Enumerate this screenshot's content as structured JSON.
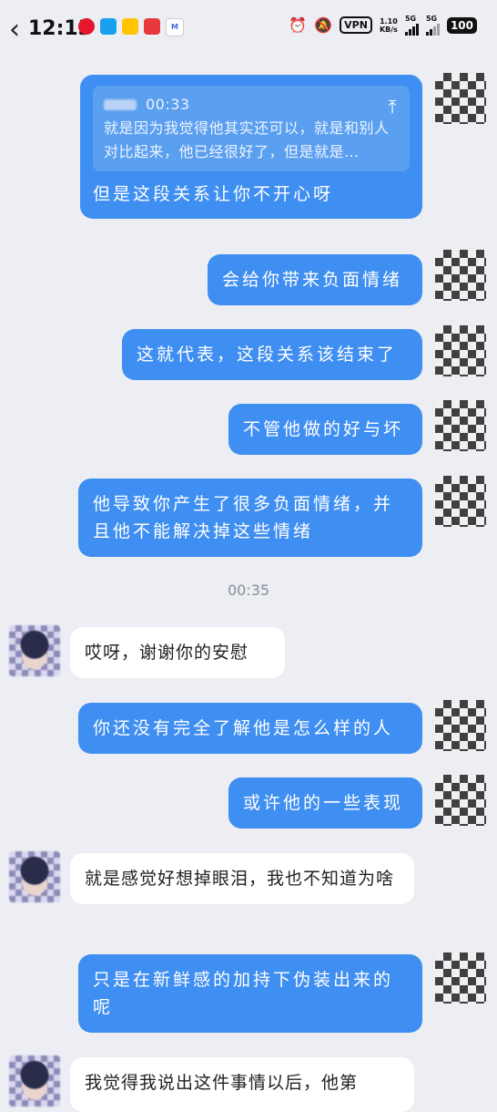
{
  "status_bar": {
    "time": "12:13",
    "vpn": "VPN",
    "speed_value": "1.10",
    "speed_unit": "KB/s",
    "net1": "5G",
    "net2": "5G",
    "battery": "100"
  },
  "messages": [
    {
      "dir": "out",
      "quote_time": "00:33",
      "quote_text": "就是因为我觉得他其实还可以，就是和别人对比起来，他已经很好了，但是就是…",
      "text": "但是这段关系让你不开心呀"
    },
    {
      "dir": "out",
      "text": "会给你带来负面情绪"
    },
    {
      "dir": "out",
      "text": "这就代表，这段关系该结束了"
    },
    {
      "dir": "out",
      "text": "不管他做的好与坏"
    },
    {
      "dir": "out",
      "text": "他导致你产生了很多负面情绪，并且他不能解决掉这些情绪"
    },
    {
      "dir": "time",
      "text": "00:35"
    },
    {
      "dir": "in",
      "text": "哎呀，谢谢你的安慰"
    },
    {
      "dir": "out",
      "text": "你还没有完全了解他是怎么样的人"
    },
    {
      "dir": "out",
      "text": "或许他的一些表现"
    },
    {
      "dir": "in",
      "text": "就是感觉好想掉眼泪，我也不知道为啥"
    },
    {
      "dir": "out",
      "text": "只是在新鲜感的加持下伪装出来的呢"
    },
    {
      "dir": "in",
      "text": "我觉得我说出这件事情以后，他第"
    }
  ]
}
